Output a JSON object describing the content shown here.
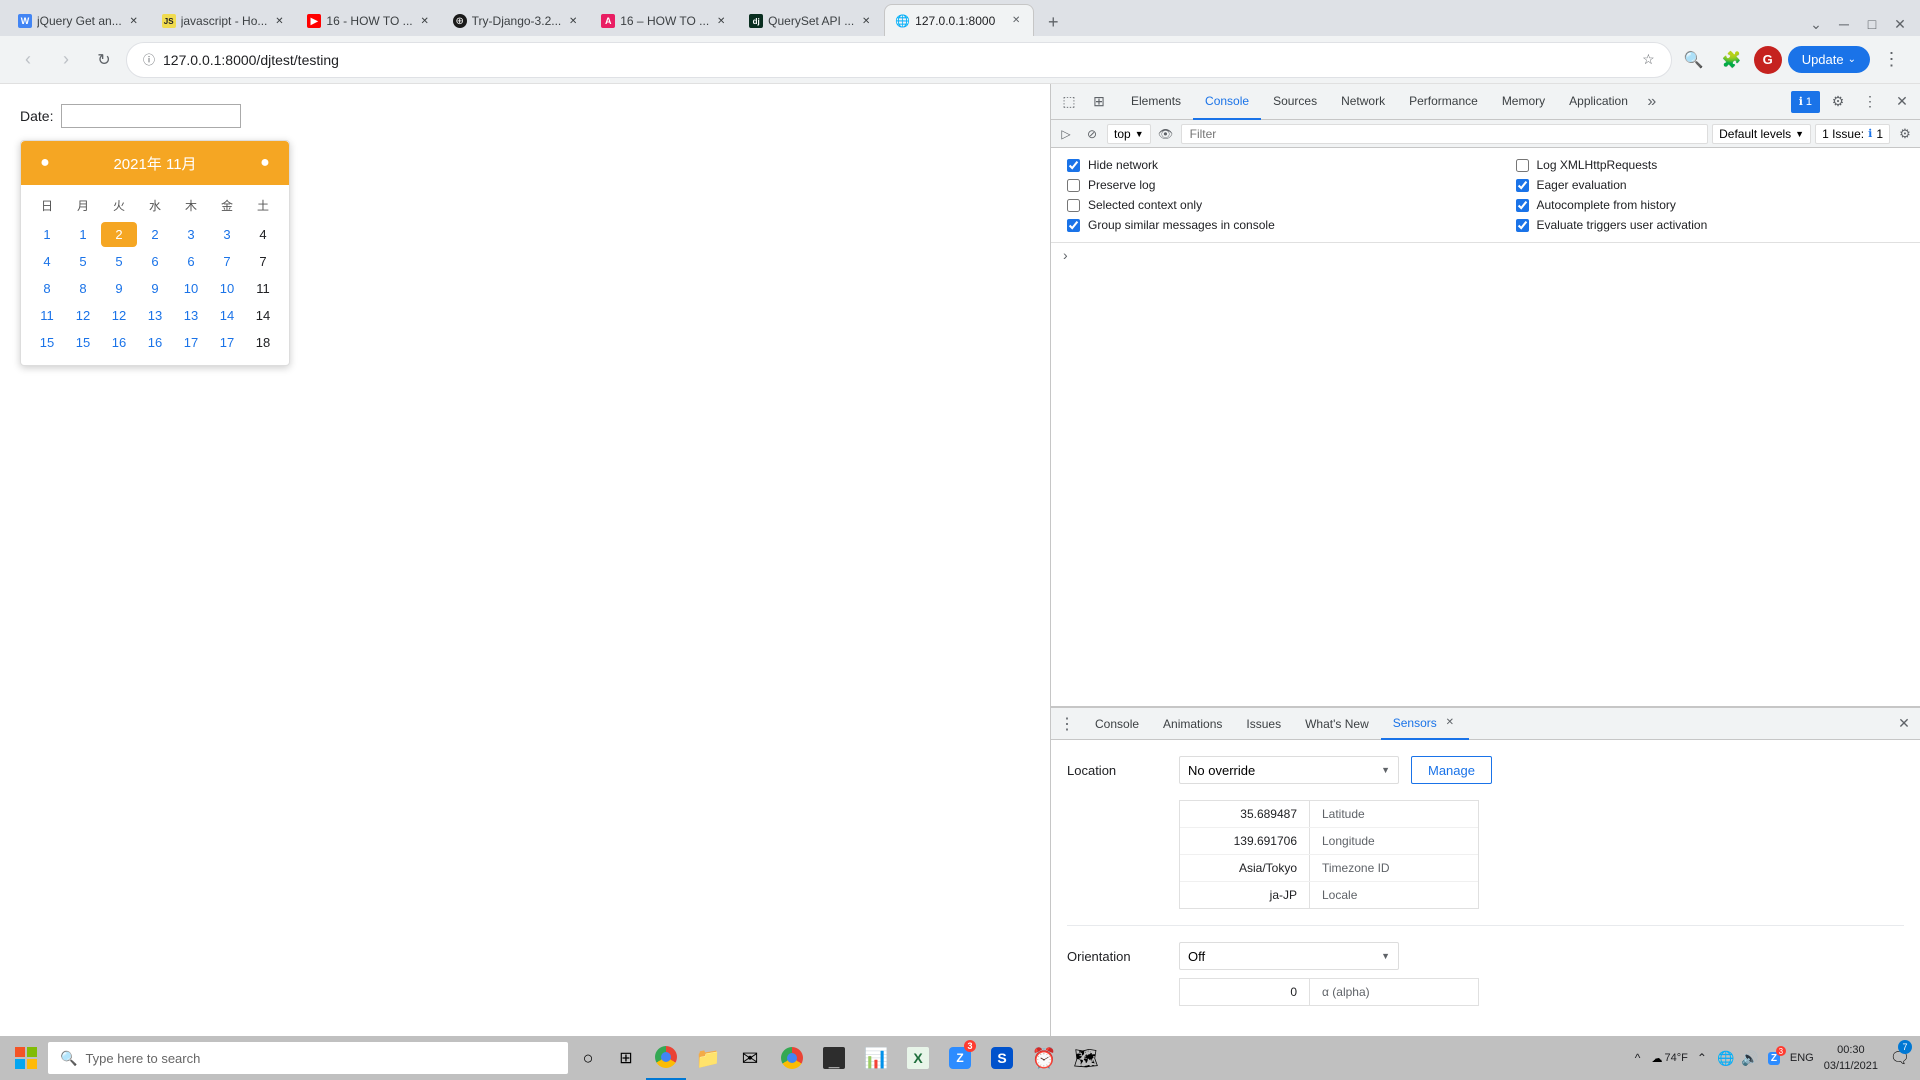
{
  "browser": {
    "tabs": [
      {
        "id": 1,
        "title": "jQuery Get an...",
        "favicon": "W",
        "favicon_color": "#4285f4",
        "active": false
      },
      {
        "id": 2,
        "title": "javascript - Ho...",
        "favicon": "JS",
        "favicon_color": "#f0db4f",
        "active": false
      },
      {
        "id": 3,
        "title": "16 - HOW TO ...",
        "favicon": "▶",
        "favicon_color": "#ff0000",
        "active": false
      },
      {
        "id": 4,
        "title": "Try-Django-3.2...",
        "favicon": "⊕",
        "favicon_color": "#1a1a1a",
        "active": false
      },
      {
        "id": 5,
        "title": "16 – HOW TO ...",
        "favicon": "A",
        "favicon_color": "#e91e63",
        "active": false
      },
      {
        "id": 6,
        "title": "QuerySet API ...",
        "favicon": "dj",
        "favicon_color": "#092e20",
        "active": false
      },
      {
        "id": 7,
        "title": "127.0.0.1:8000",
        "favicon": "🌐",
        "favicon_color": "#888",
        "active": true
      }
    ],
    "url": "127.0.0.1:8000/djtest/testing",
    "url_protocol": "127.0.0.1:8000/djtest/testing"
  },
  "page": {
    "date_label": "Date:",
    "date_input_value": ""
  },
  "calendar": {
    "header": "2021年 11月",
    "weekdays": [
      "日",
      "月",
      "火",
      "水",
      "木",
      "金",
      "土"
    ],
    "weeks": [
      [
        {
          "day": "1",
          "type": "blue",
          "prev": true
        },
        {
          "day": "1",
          "type": "blue",
          "prev": true
        },
        {
          "day": "2",
          "type": "today"
        },
        {
          "day": "2",
          "type": "blue"
        },
        {
          "day": "3",
          "type": "blue"
        },
        {
          "day": "3",
          "type": "blue"
        },
        {
          "day": "4",
          "type": "black"
        }
      ],
      [
        {
          "day": "4",
          "type": "blue"
        },
        {
          "day": "5",
          "type": "blue"
        },
        {
          "day": "5",
          "type": "today-outline"
        },
        {
          "day": "6",
          "type": "blue"
        },
        {
          "day": "6",
          "type": "blue"
        },
        {
          "day": "7",
          "type": "blue"
        },
        {
          "day": "7",
          "type": "black"
        }
      ],
      [
        {
          "day": "8",
          "type": "blue"
        },
        {
          "day": "8",
          "type": "blue"
        },
        {
          "day": "9",
          "type": "blue"
        },
        {
          "day": "9",
          "type": "blue"
        },
        {
          "day": "10",
          "type": "blue"
        },
        {
          "day": "10",
          "type": "blue"
        },
        {
          "day": "11",
          "type": "black"
        }
      ],
      [
        {
          "day": "11",
          "type": "blue"
        },
        {
          "day": "12",
          "type": "blue"
        },
        {
          "day": "12",
          "type": "blue"
        },
        {
          "day": "13",
          "type": "blue"
        },
        {
          "day": "13",
          "type": "blue"
        },
        {
          "day": "14",
          "type": "blue"
        },
        {
          "day": "14",
          "type": "black"
        }
      ],
      [
        {
          "day": "15",
          "type": "blue"
        },
        {
          "day": "15",
          "type": "blue"
        },
        {
          "day": "16",
          "type": "blue"
        },
        {
          "day": "16",
          "type": "blue"
        },
        {
          "day": "17",
          "type": "blue"
        },
        {
          "day": "17",
          "type": "blue"
        },
        {
          "day": "18",
          "type": "black"
        }
      ]
    ]
  },
  "devtools": {
    "tabs": [
      {
        "label": "Elements",
        "active": false
      },
      {
        "label": "Console",
        "active": true
      },
      {
        "label": "Sources",
        "active": false
      },
      {
        "label": "Network",
        "active": false
      },
      {
        "label": "Performance",
        "active": false
      },
      {
        "label": "Memory",
        "active": false
      },
      {
        "label": "Application",
        "active": false
      }
    ],
    "console": {
      "context": "top",
      "filter_placeholder": "Filter",
      "default_levels": "Default levels",
      "issue_label": "1 Issue:",
      "issue_count": "1",
      "settings": {
        "hide_network": {
          "label": "Hide network",
          "checked": true
        },
        "preserve_log": {
          "label": "Preserve log",
          "checked": false
        },
        "selected_context": {
          "label": "Selected context only",
          "checked": false
        },
        "group_similar": {
          "label": "Group similar messages in console",
          "checked": true
        },
        "log_xml": {
          "label": "Log XMLHttpRequests",
          "checked": false
        },
        "eager_eval": {
          "label": "Eager evaluation",
          "checked": true
        },
        "autocomplete": {
          "label": "Autocomplete from history",
          "checked": true
        },
        "eval_triggers": {
          "label": "Evaluate triggers user activation",
          "checked": true
        }
      }
    }
  },
  "bottom_panel": {
    "tabs": [
      {
        "label": "Console",
        "active": false,
        "closeable": false
      },
      {
        "label": "Animations",
        "active": false,
        "closeable": false
      },
      {
        "label": "Issues",
        "active": false,
        "closeable": false
      },
      {
        "label": "What's New",
        "active": false,
        "closeable": false
      },
      {
        "label": "Sensors",
        "active": true,
        "closeable": true
      }
    ],
    "sensors": {
      "location_label": "Location",
      "location_value": "No override",
      "manage_btn": "Manage",
      "latitude": "35.689487",
      "latitude_label": "Latitude",
      "longitude": "139.691706",
      "longitude_label": "Longitude",
      "timezone": "Asia/Tokyo",
      "timezone_label": "Timezone ID",
      "locale": "ja-JP",
      "locale_label": "Locale",
      "orientation_label": "Orientation",
      "orientation_value": "Off",
      "alpha_label": "α (alpha)",
      "alpha_value": "0"
    }
  },
  "taskbar": {
    "search_placeholder": "Type here to search",
    "clock_time": "00:30",
    "clock_date": "03/11/2021",
    "temperature": "74°F",
    "language": "ENG",
    "notification_count": "7",
    "apps": [
      {
        "name": "chrome",
        "symbol": "●",
        "color": "#4285f4"
      },
      {
        "name": "explorer",
        "symbol": "📁",
        "color": "#f5a623"
      },
      {
        "name": "mail",
        "symbol": "✉",
        "color": "#0078d4"
      },
      {
        "name": "chrome-app",
        "symbol": "◎",
        "color": "#4285f4"
      },
      {
        "name": "terminal",
        "symbol": "■",
        "color": "#202124"
      },
      {
        "name": "powerpoint",
        "symbol": "P",
        "color": "#d04423"
      },
      {
        "name": "excel",
        "symbol": "X",
        "color": "#1e6e3b"
      },
      {
        "name": "zoom",
        "symbol": "Z",
        "color": "#2d8cff"
      },
      {
        "name": "sourcetree",
        "symbol": "S",
        "color": "#0052cc"
      },
      {
        "name": "clock-app",
        "symbol": "⊙",
        "color": "#0078d4"
      },
      {
        "name": "maps",
        "symbol": "◈",
        "color": "#34a853"
      }
    ]
  }
}
